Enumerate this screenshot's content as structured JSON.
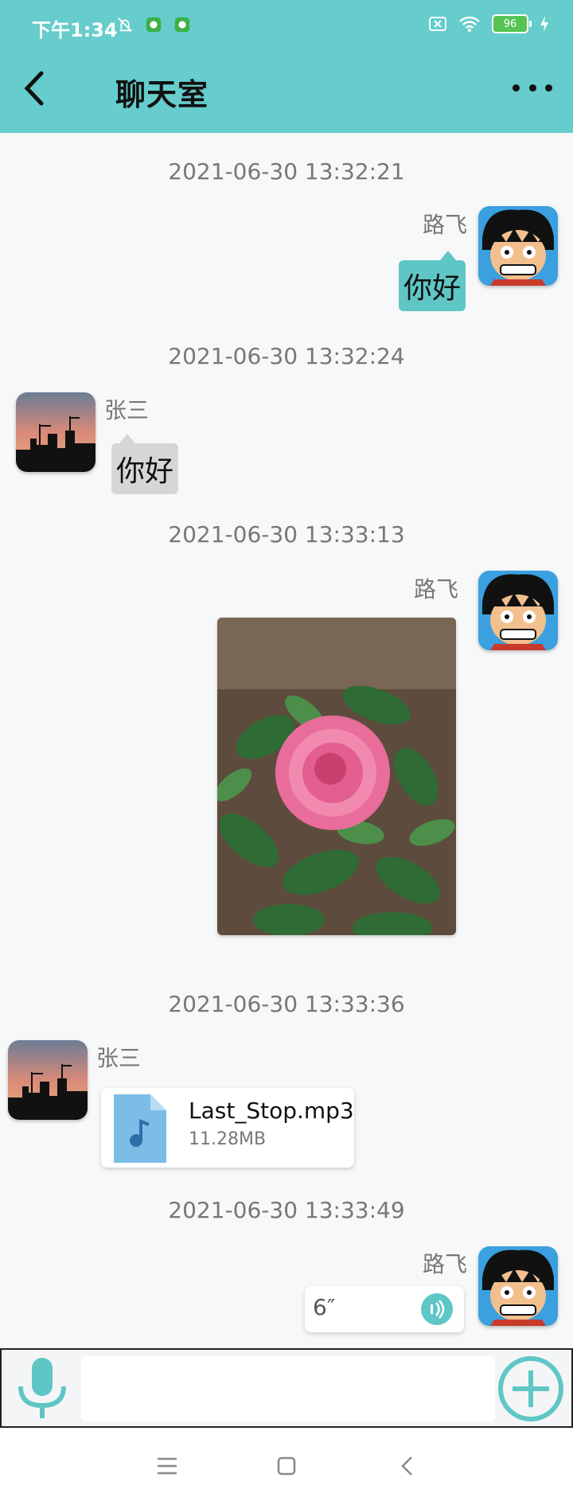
{
  "status_bar": {
    "time": "下午1:34",
    "battery": "96"
  },
  "header": {
    "title": "聊天室"
  },
  "messages": [
    {
      "timestamp": "2021-06-30 13:32:21",
      "sender": "路飞",
      "text": "你好"
    },
    {
      "timestamp": "2021-06-30 13:32:24",
      "sender": "张三",
      "text": "你好"
    },
    {
      "timestamp": "2021-06-30 13:33:13",
      "sender": "路飞"
    },
    {
      "timestamp": "2021-06-30 13:33:36",
      "sender": "张三",
      "file_name": "Last_Stop.mp3",
      "file_size": "11.28MB"
    },
    {
      "timestamp": "2021-06-30 13:33:49",
      "sender": "路飞",
      "voice_duration": "6″"
    }
  ],
  "input": {
    "placeholder": ""
  },
  "colors": {
    "accent": "#66cccc",
    "bubble_right": "#5fc6c6",
    "bubble_left": "#d6d6d6"
  },
  "icons": [
    "back-arrow-icon",
    "more-dots-icon",
    "mic-icon",
    "plus-icon",
    "music-file-icon",
    "voice-wave-icon",
    "menu-nav-icon",
    "home-nav-icon",
    "back-nav-icon"
  ]
}
